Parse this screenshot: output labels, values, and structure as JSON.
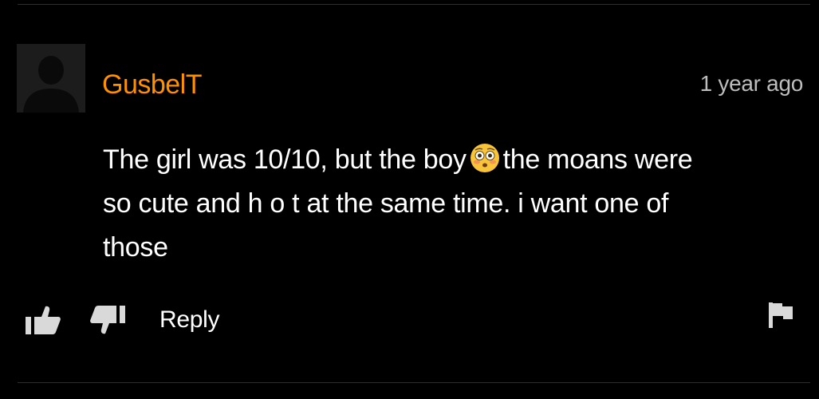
{
  "comment": {
    "author": "GusbelT",
    "timestamp": "1 year ago",
    "text_lines": [
      [
        "The girl was 10/10, but the boy",
        "the moans were"
      ],
      [
        "so cute and h o t at the same time. i want one of"
      ],
      [
        "those"
      ]
    ],
    "emoji": "flushed-face"
  },
  "actions": {
    "reply_label": "Reply",
    "icons": [
      "thumbs-up-icon",
      "thumbs-down-icon",
      "flag-icon"
    ]
  },
  "colors": {
    "background": "#000000",
    "author": "#ff9000",
    "text": "#ffffff",
    "timestamp": "#bdbdbd",
    "icon": "#d9d9d9"
  }
}
